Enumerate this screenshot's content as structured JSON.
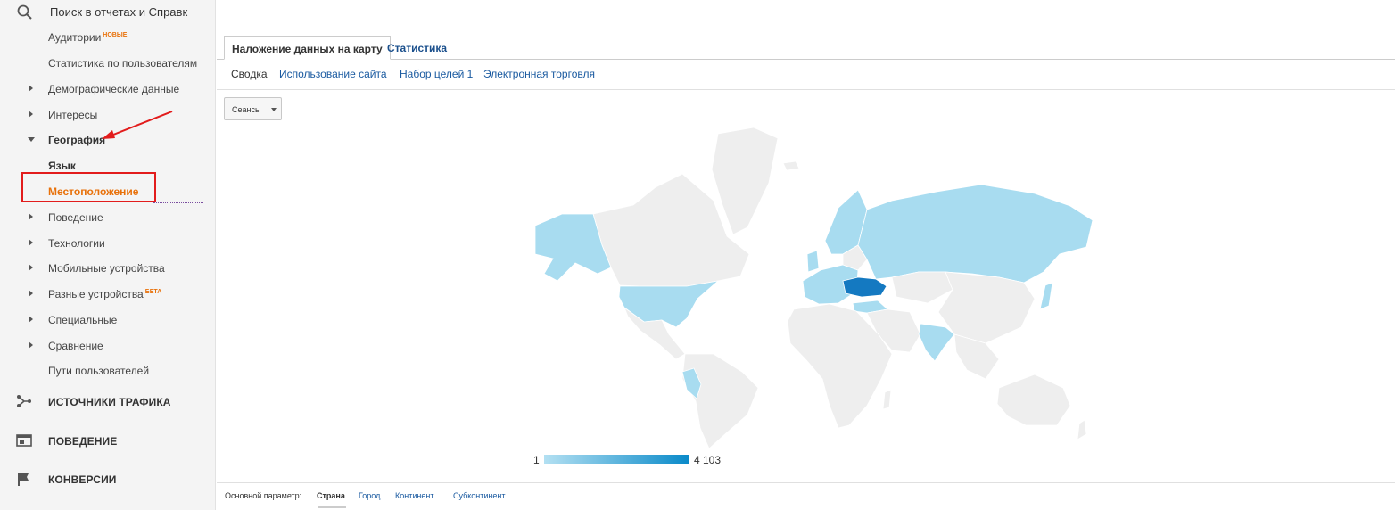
{
  "search": {
    "label": "Поиск в отчетах и Справк"
  },
  "nav": {
    "audiences": "Аудитории",
    "audiences_badge": "НОВЫЕ",
    "user_stats": "Статистика по пользователям",
    "demographics": "Демографические данные",
    "interests": "Интересы",
    "geo": "География",
    "language": "Язык",
    "location": "Местоположение",
    "behavior": "Поведение",
    "technology": "Технологии",
    "mobile": "Мобильные устройства",
    "cross_device": "Разные устройства",
    "cross_device_badge": "БЕТА",
    "custom": "Специальные",
    "benchmarking": "Сравнение",
    "user_flow": "Пути пользователей"
  },
  "sections": {
    "acquisition": "ИСТОЧНИКИ ТРАФИКА",
    "behavior": "ПОВЕДЕНИЕ",
    "conversions": "КОНВЕРСИИ"
  },
  "tabs": {
    "map_overlay": "Наложение данных на карту",
    "explorer": "Статистика"
  },
  "subtabs": [
    "Сводка",
    "Использование сайта",
    "Набор целей 1",
    "Электронная торговля"
  ],
  "metric_dropdown": {
    "value": "Сеансы"
  },
  "legend": {
    "min": "1",
    "max": "4 103"
  },
  "primary_dimension": {
    "label": "Основной параметр:",
    "current": "Страна",
    "options": [
      "Город",
      "Континент",
      "Субконтинент"
    ]
  },
  "colors": {
    "accent_orange": "#e8710a",
    "link_blue": "#1a5aa0",
    "map_low": "#a8dcf0",
    "map_high": "#1479c1",
    "land_neutral": "#eeeeee",
    "highlight_red": "#e21c1c"
  }
}
